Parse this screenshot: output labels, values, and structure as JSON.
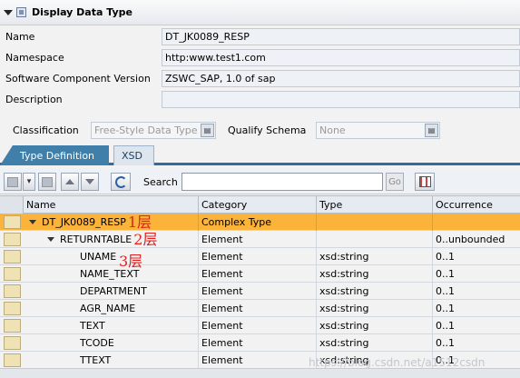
{
  "panel": {
    "title": "Display Data Type"
  },
  "fields": {
    "name_label": "Name",
    "name_value": "DT_JK0089_RESP",
    "namespace_label": "Namespace",
    "namespace_value": "http:www.test1.com",
    "swcv_label": "Software Component Version",
    "swcv_value": "ZSWC_SAP, 1.0 of sap",
    "description_label": "Description",
    "description_value": ""
  },
  "classification": {
    "label": "Classification",
    "value": "Free-Style Data Type",
    "qualify_label": "Qualify Schema",
    "qualify_value": "None"
  },
  "tabs": [
    {
      "label": "Type Definition",
      "active": true
    },
    {
      "label": "XSD",
      "active": false
    }
  ],
  "toolbar": {
    "search_label": "Search",
    "search_value": "",
    "go_label": "Go"
  },
  "table": {
    "columns": [
      "Name",
      "Category",
      "Type",
      "Occurrence"
    ],
    "rows": [
      {
        "name": "DT_JK0089_RESP",
        "category": "Complex Type",
        "type": "",
        "occurrence": "",
        "level": 0,
        "annotation": "1层"
      },
      {
        "name": "RETURNTABLE",
        "category": "Element",
        "type": "",
        "occurrence": "0..unbounded",
        "level": 1,
        "annotation": "2层"
      },
      {
        "name": "UNAME",
        "category": "Element",
        "type": "xsd:string",
        "occurrence": "0..1",
        "level": 2
      },
      {
        "name": "NAME_TEXT",
        "category": "Element",
        "type": "xsd:string",
        "occurrence": "0..1",
        "level": 2
      },
      {
        "name": "DEPARTMENT",
        "category": "Element",
        "type": "xsd:string",
        "occurrence": "0..1",
        "level": 2
      },
      {
        "name": "AGR_NAME",
        "category": "Element",
        "type": "xsd:string",
        "occurrence": "0..1",
        "level": 2
      },
      {
        "name": "TEXT",
        "category": "Element",
        "type": "xsd:string",
        "occurrence": "0..1",
        "level": 2
      },
      {
        "name": "TCODE",
        "category": "Element",
        "type": "xsd:string",
        "occurrence": "0..1",
        "level": 2
      },
      {
        "name": "TTEXT",
        "category": "Element",
        "type": "xsd:string",
        "occurrence": "0..1",
        "level": 2
      }
    ]
  },
  "annotation3": "3层",
  "watermark": "https://blog.csdn.net/a1512csdn",
  "colors": {
    "highlight_row": "#fbb33a",
    "active_tab": "#3f7faa",
    "annotation": "#e02020"
  }
}
